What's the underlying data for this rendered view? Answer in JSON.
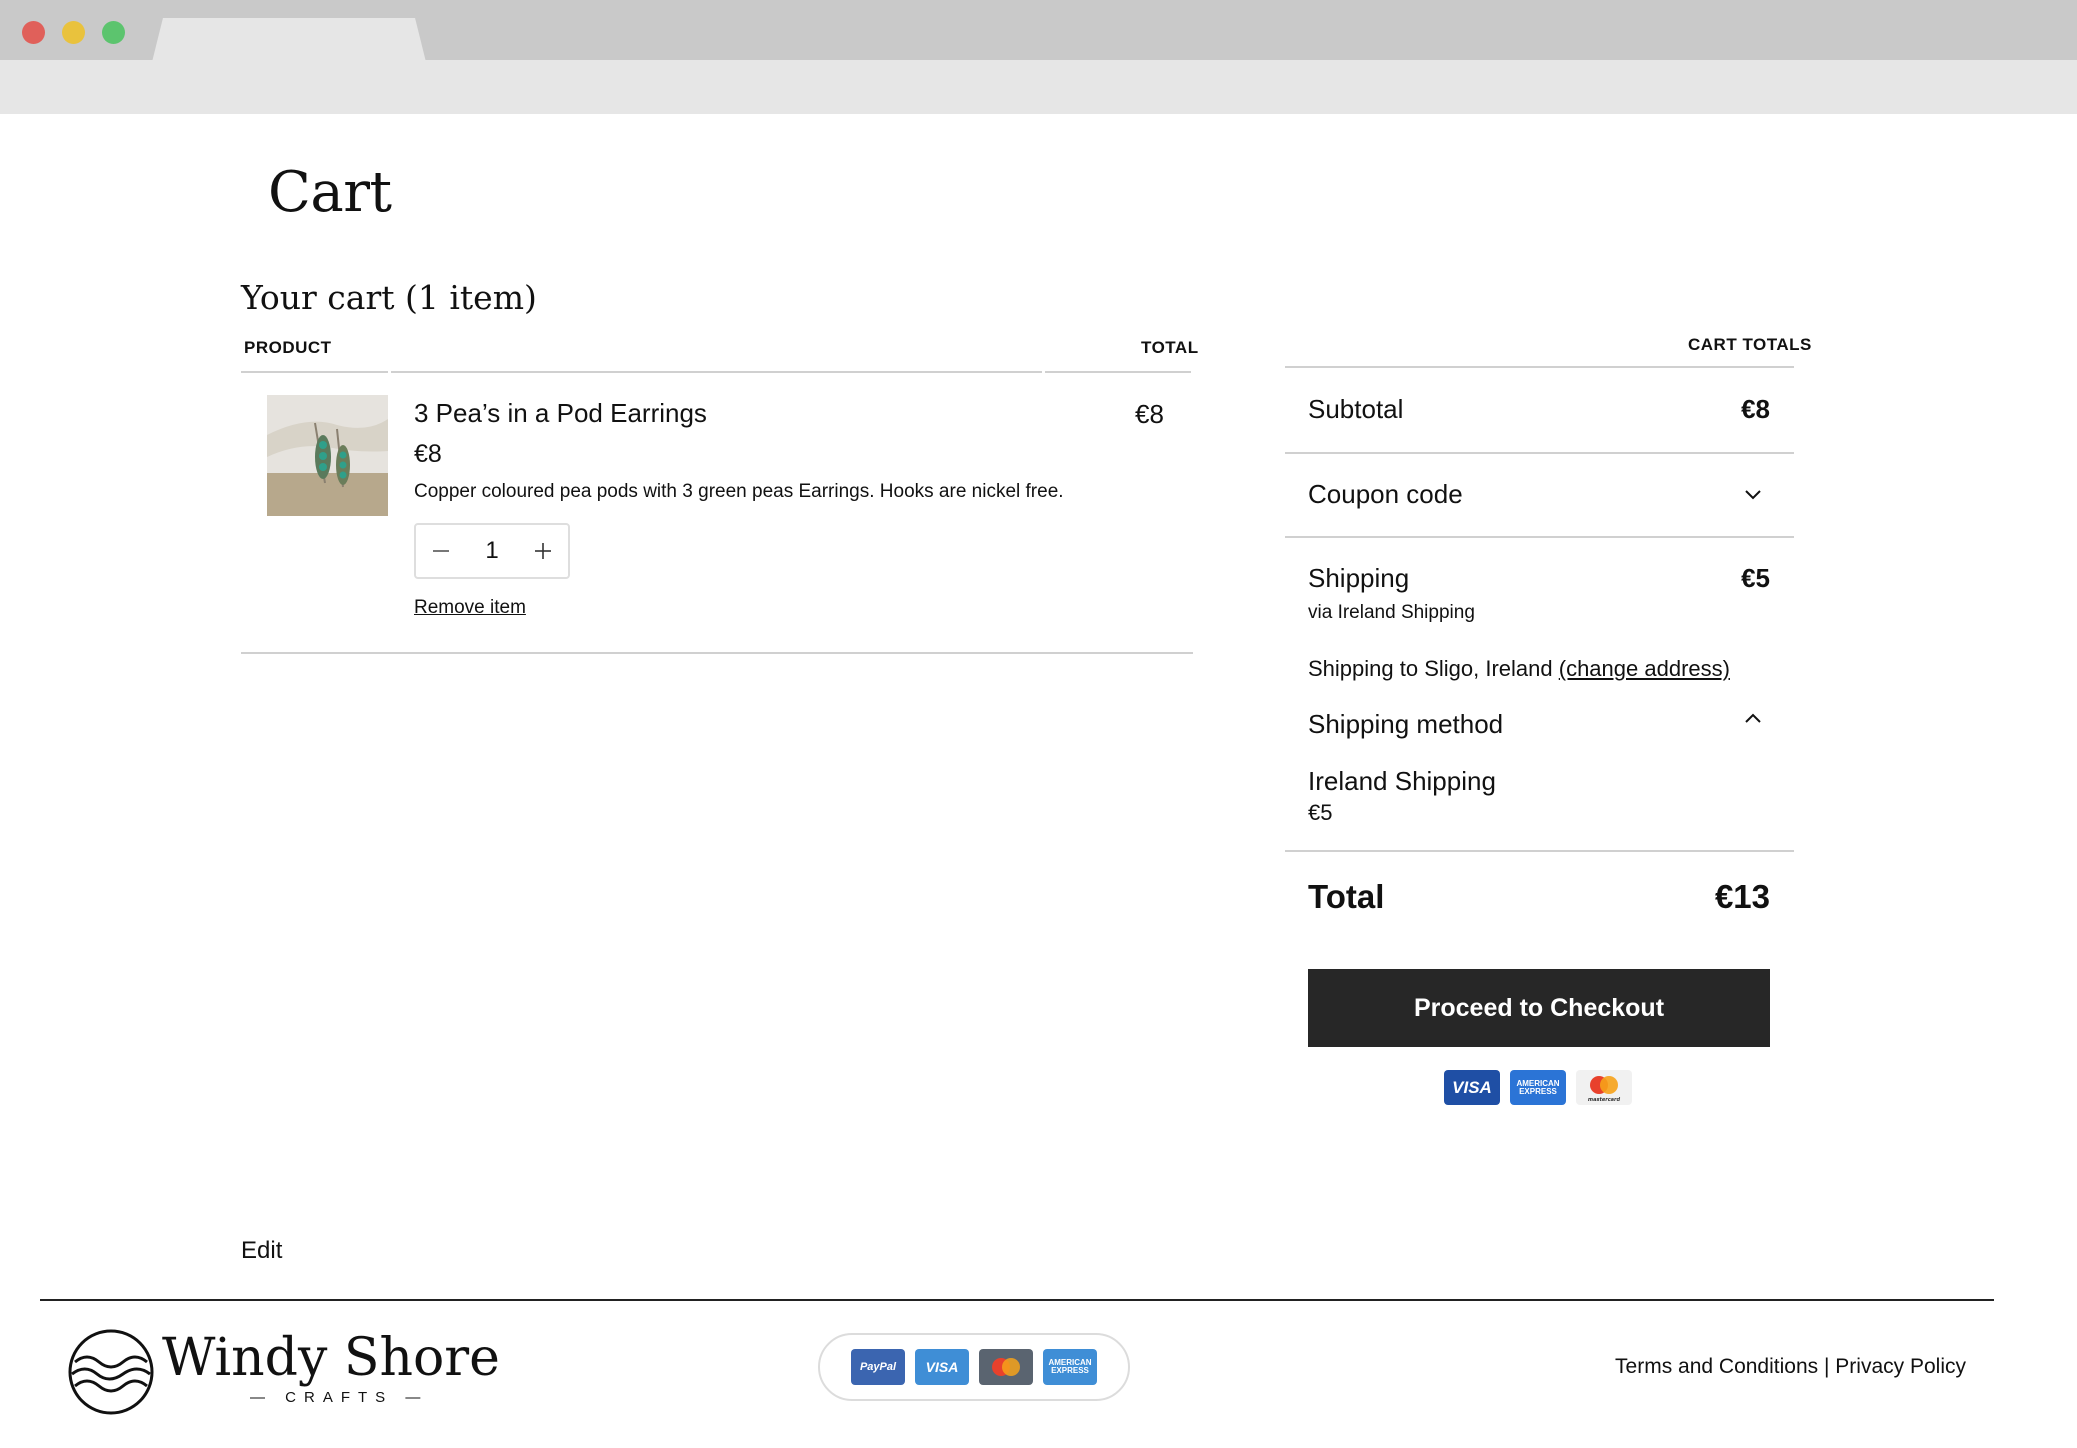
{
  "page": {
    "title": "Cart"
  },
  "cart": {
    "heading": "Your cart (1 item)",
    "columns": {
      "product": "PRODUCT",
      "total": "TOTAL"
    },
    "items": [
      {
        "name": "3 Pea’s in a Pod Earrings",
        "price": "€8",
        "description": "Copper coloured pea pods with 3 green peas Earrings. Hooks are nickel free.",
        "quantity": "1",
        "line_total": "€8",
        "remove_label": "Remove item",
        "image_icon": "earrings-product-photo"
      }
    ]
  },
  "totals": {
    "heading": "CART TOTALS",
    "subtotal_label": "Subtotal",
    "subtotal_value": "€8",
    "coupon_label": "Coupon code",
    "shipping_label": "Shipping",
    "shipping_value": "€5",
    "shipping_via": "via Ireland Shipping",
    "shipping_to_text": "Shipping to Sligo, Ireland",
    "change_address_label": "(change address)",
    "shipping_method_label": "Shipping method",
    "method_name": "Ireland Shipping",
    "method_price": "€5",
    "total_label": "Total",
    "total_value": "€13",
    "checkout_label": "Proceed to Checkout",
    "payment_cards": {
      "visa": "VISA",
      "amex": "AMERICAN EXPRESS",
      "mastercard": "mastercard"
    }
  },
  "footer": {
    "edit_label": "Edit",
    "logo_text": "Windy Shore",
    "logo_subtext": "CRAFTS",
    "payment_badges": {
      "paypal": "PayPal",
      "visa": "VISA",
      "amex": "AMERICAN EXPRESS"
    },
    "links": {
      "terms": "Terms and Conditions",
      "separator": "|",
      "privacy": "Privacy Policy"
    }
  },
  "colors": {
    "accent": "#272727",
    "divider": "#d0d0d0",
    "chrome": "#c9c9c9"
  }
}
